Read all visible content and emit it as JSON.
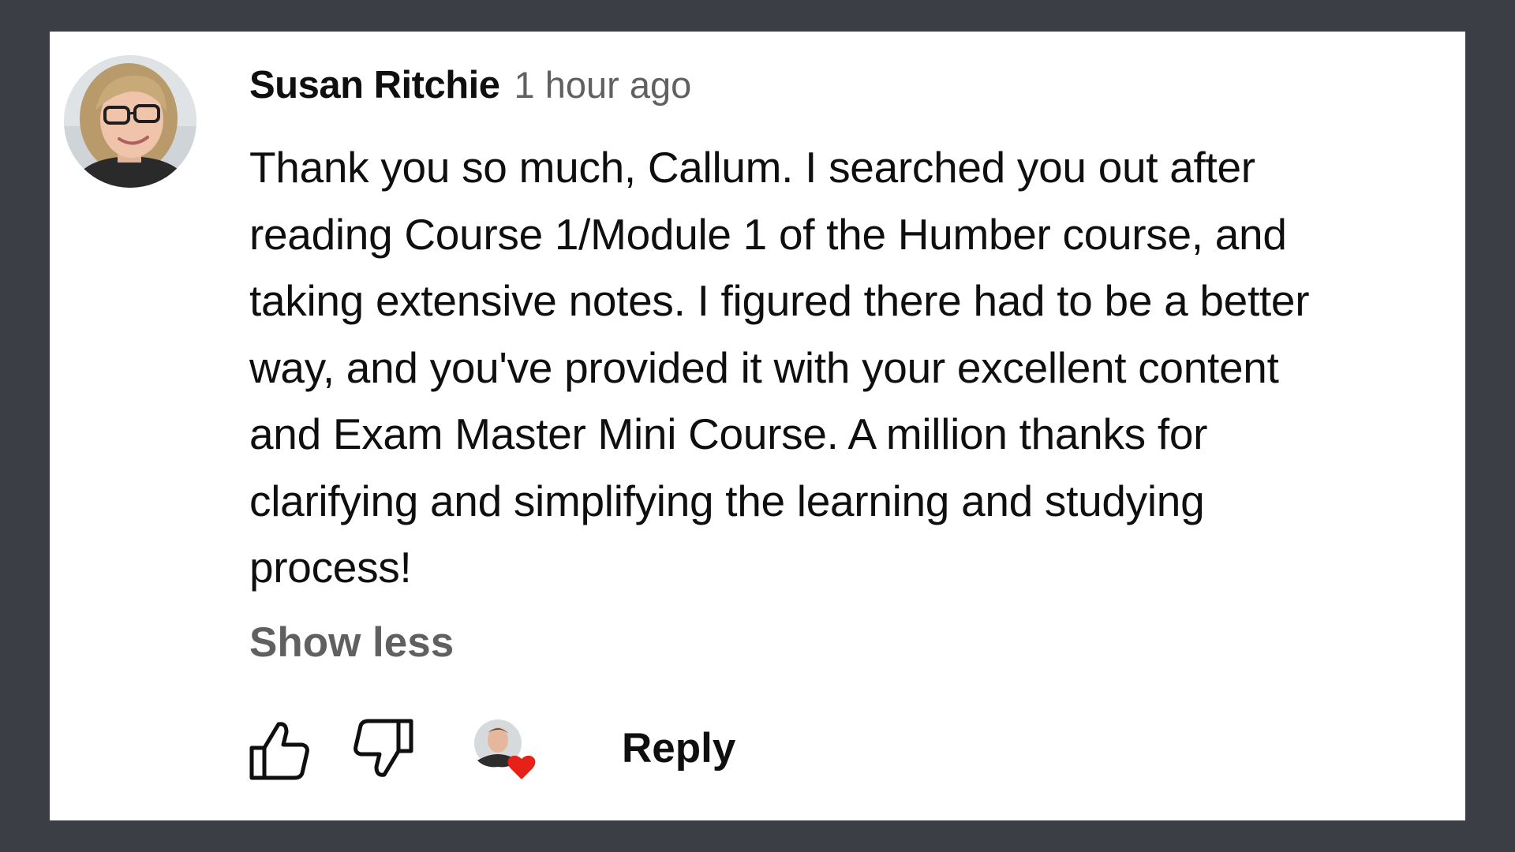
{
  "comment": {
    "author": "Susan Ritchie",
    "timestamp": "1 hour ago",
    "text_lines": [
      "Thank you so much, Callum. I searched you out after",
      "reading Course 1/Module 1 of the Humber course, and",
      "taking extensive notes. I figured there had to be a better",
      "way, and you've provided it with your excellent content",
      "and Exam Master Mini Course. A million thanks for",
      "clarifying and simplifying the learning and studying",
      "process!"
    ],
    "show_less_label": "Show less",
    "reply_label": "Reply"
  },
  "icons": {
    "like": "thumbs-up-icon",
    "dislike": "thumbs-down-icon",
    "creator_heart": "creator-heart-icon"
  },
  "colors": {
    "background": "#3b3e44",
    "card": "#ffffff",
    "text": "#0f0f0f",
    "muted": "#606060",
    "heart": "#e62117"
  }
}
